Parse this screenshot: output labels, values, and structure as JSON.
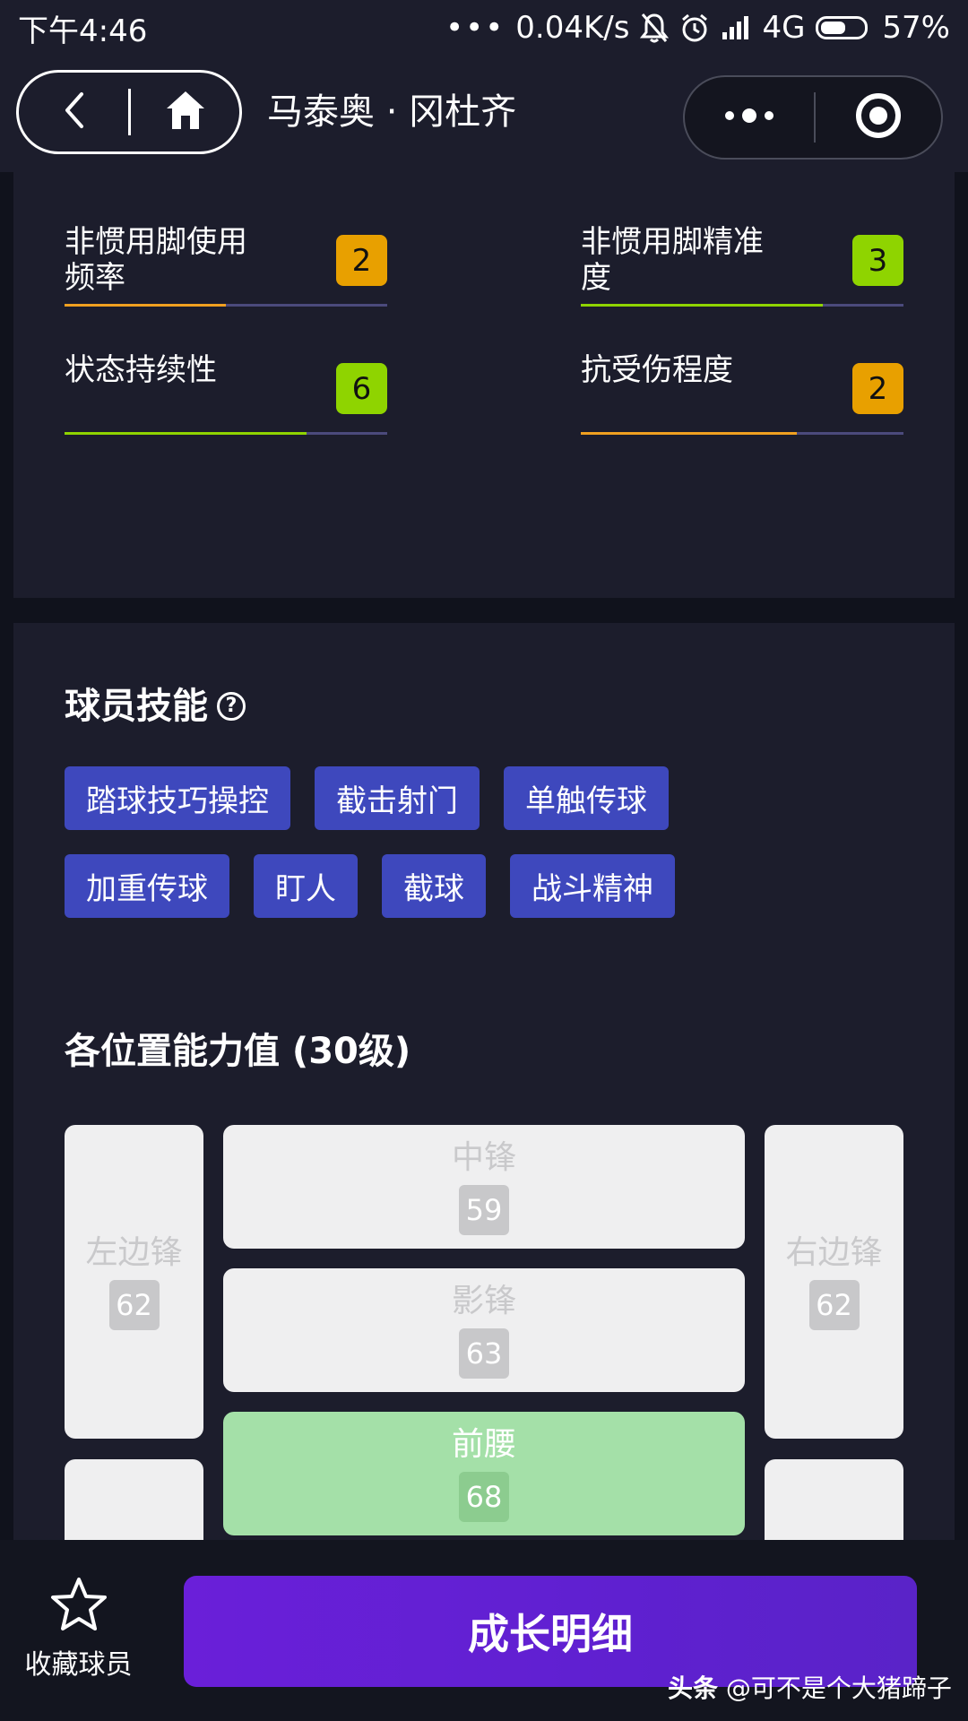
{
  "status_bar": {
    "time": "下午4:46",
    "dots": "•••",
    "network_speed": "0.04K/s",
    "signal": "4G",
    "battery": "57%",
    "battery_level": 0.57
  },
  "nav": {
    "title": "马泰奥 · 冈杜齐"
  },
  "stats": [
    {
      "label": "非惯用脚使用频率",
      "value": "2",
      "badge_color": "#e8a000",
      "bar_color": "#f0a020",
      "fill": 0.5
    },
    {
      "label": "非惯用脚精准度",
      "value": "3",
      "badge_color": "#8fd400",
      "bar_color": "#8fd400",
      "fill": 0.75
    },
    {
      "label": "状态持续性",
      "value": "6",
      "badge_color": "#8fd400",
      "bar_color": "#8fd400",
      "fill": 0.75
    },
    {
      "label": "抗受伤程度",
      "value": "2",
      "badge_color": "#e8a000",
      "bar_color": "#f0a020",
      "fill": 0.67
    }
  ],
  "skills_section": {
    "title": "球员技能",
    "help_glyph": "?",
    "rows": [
      [
        "踏球技巧操控",
        "截击射门",
        "单触传球"
      ],
      [
        "加重传球",
        "盯人",
        "截球",
        "战斗精神"
      ]
    ]
  },
  "positions_section": {
    "title": "各位置能力值 (30级)",
    "positions": [
      {
        "name": "左边锋",
        "value": "62",
        "active": false
      },
      {
        "name": "中锋",
        "value": "59",
        "active": false
      },
      {
        "name": "右边锋",
        "value": "62",
        "active": false
      },
      {
        "name": "影锋",
        "value": "63",
        "active": false
      },
      {
        "name": "前腰",
        "value": "68",
        "active": true
      }
    ]
  },
  "bottom": {
    "favorite_label": "收藏球员",
    "growth_button": "成长明细"
  },
  "watermark": {
    "source": "头条",
    "author": "@可不是个大猪蹄子"
  }
}
